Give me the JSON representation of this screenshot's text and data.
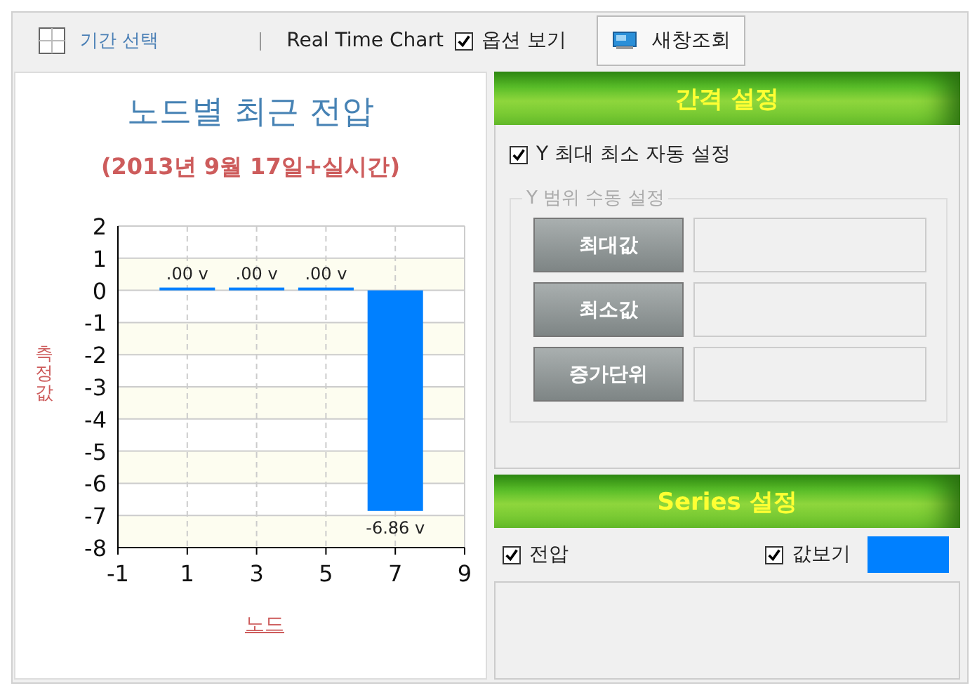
{
  "toolbar": {
    "period_button": "기간 선택",
    "label": "Real Time Chart",
    "options_checkbox": {
      "label": "옵션 보기",
      "checked": true
    },
    "new_window_button": "새창조회"
  },
  "chart_panel": {
    "subtitle": "(2013년 9월 17일+실시간)",
    "chart_data": {
      "type": "bar",
      "title": "노드별 최근 전압",
      "xlabel": "노드",
      "ylabel": "측정값",
      "x": [
        1,
        3,
        5,
        7
      ],
      "series": [
        {
          "color": "#0080ff",
          "values": [
            0,
            0,
            0,
            -6.86
          ]
        }
      ],
      "grid": true,
      "xlim": [
        -1,
        9
      ],
      "ylim": [
        -8,
        2
      ],
      "xticks": [
        -1,
        1,
        3,
        5,
        7,
        9
      ],
      "yticks": [
        -8,
        -7,
        -6,
        -5,
        -4,
        -3,
        -2,
        -1,
        0,
        1,
        2
      ],
      "value_labels": [
        ".00 v",
        ".00 v",
        ".00 v",
        "-6.86 v"
      ]
    }
  },
  "interval_settings": {
    "header": "간격 설정",
    "auto_checkbox": {
      "label": "Y 최대 최소 자동 설정",
      "checked": true
    },
    "manual_group": {
      "legend": "Y 범위 수동 설정",
      "disabled": true,
      "fields": [
        {
          "button": "최대값"
        },
        {
          "button": "최소값"
        },
        {
          "button": "증가단위"
        }
      ]
    }
  },
  "series_settings": {
    "header": "Series 설정",
    "series": [
      {
        "label": "전압",
        "checked": true,
        "show_values": {
          "label": "값보기",
          "checked": true
        },
        "color": "#0080ff"
      }
    ]
  }
}
